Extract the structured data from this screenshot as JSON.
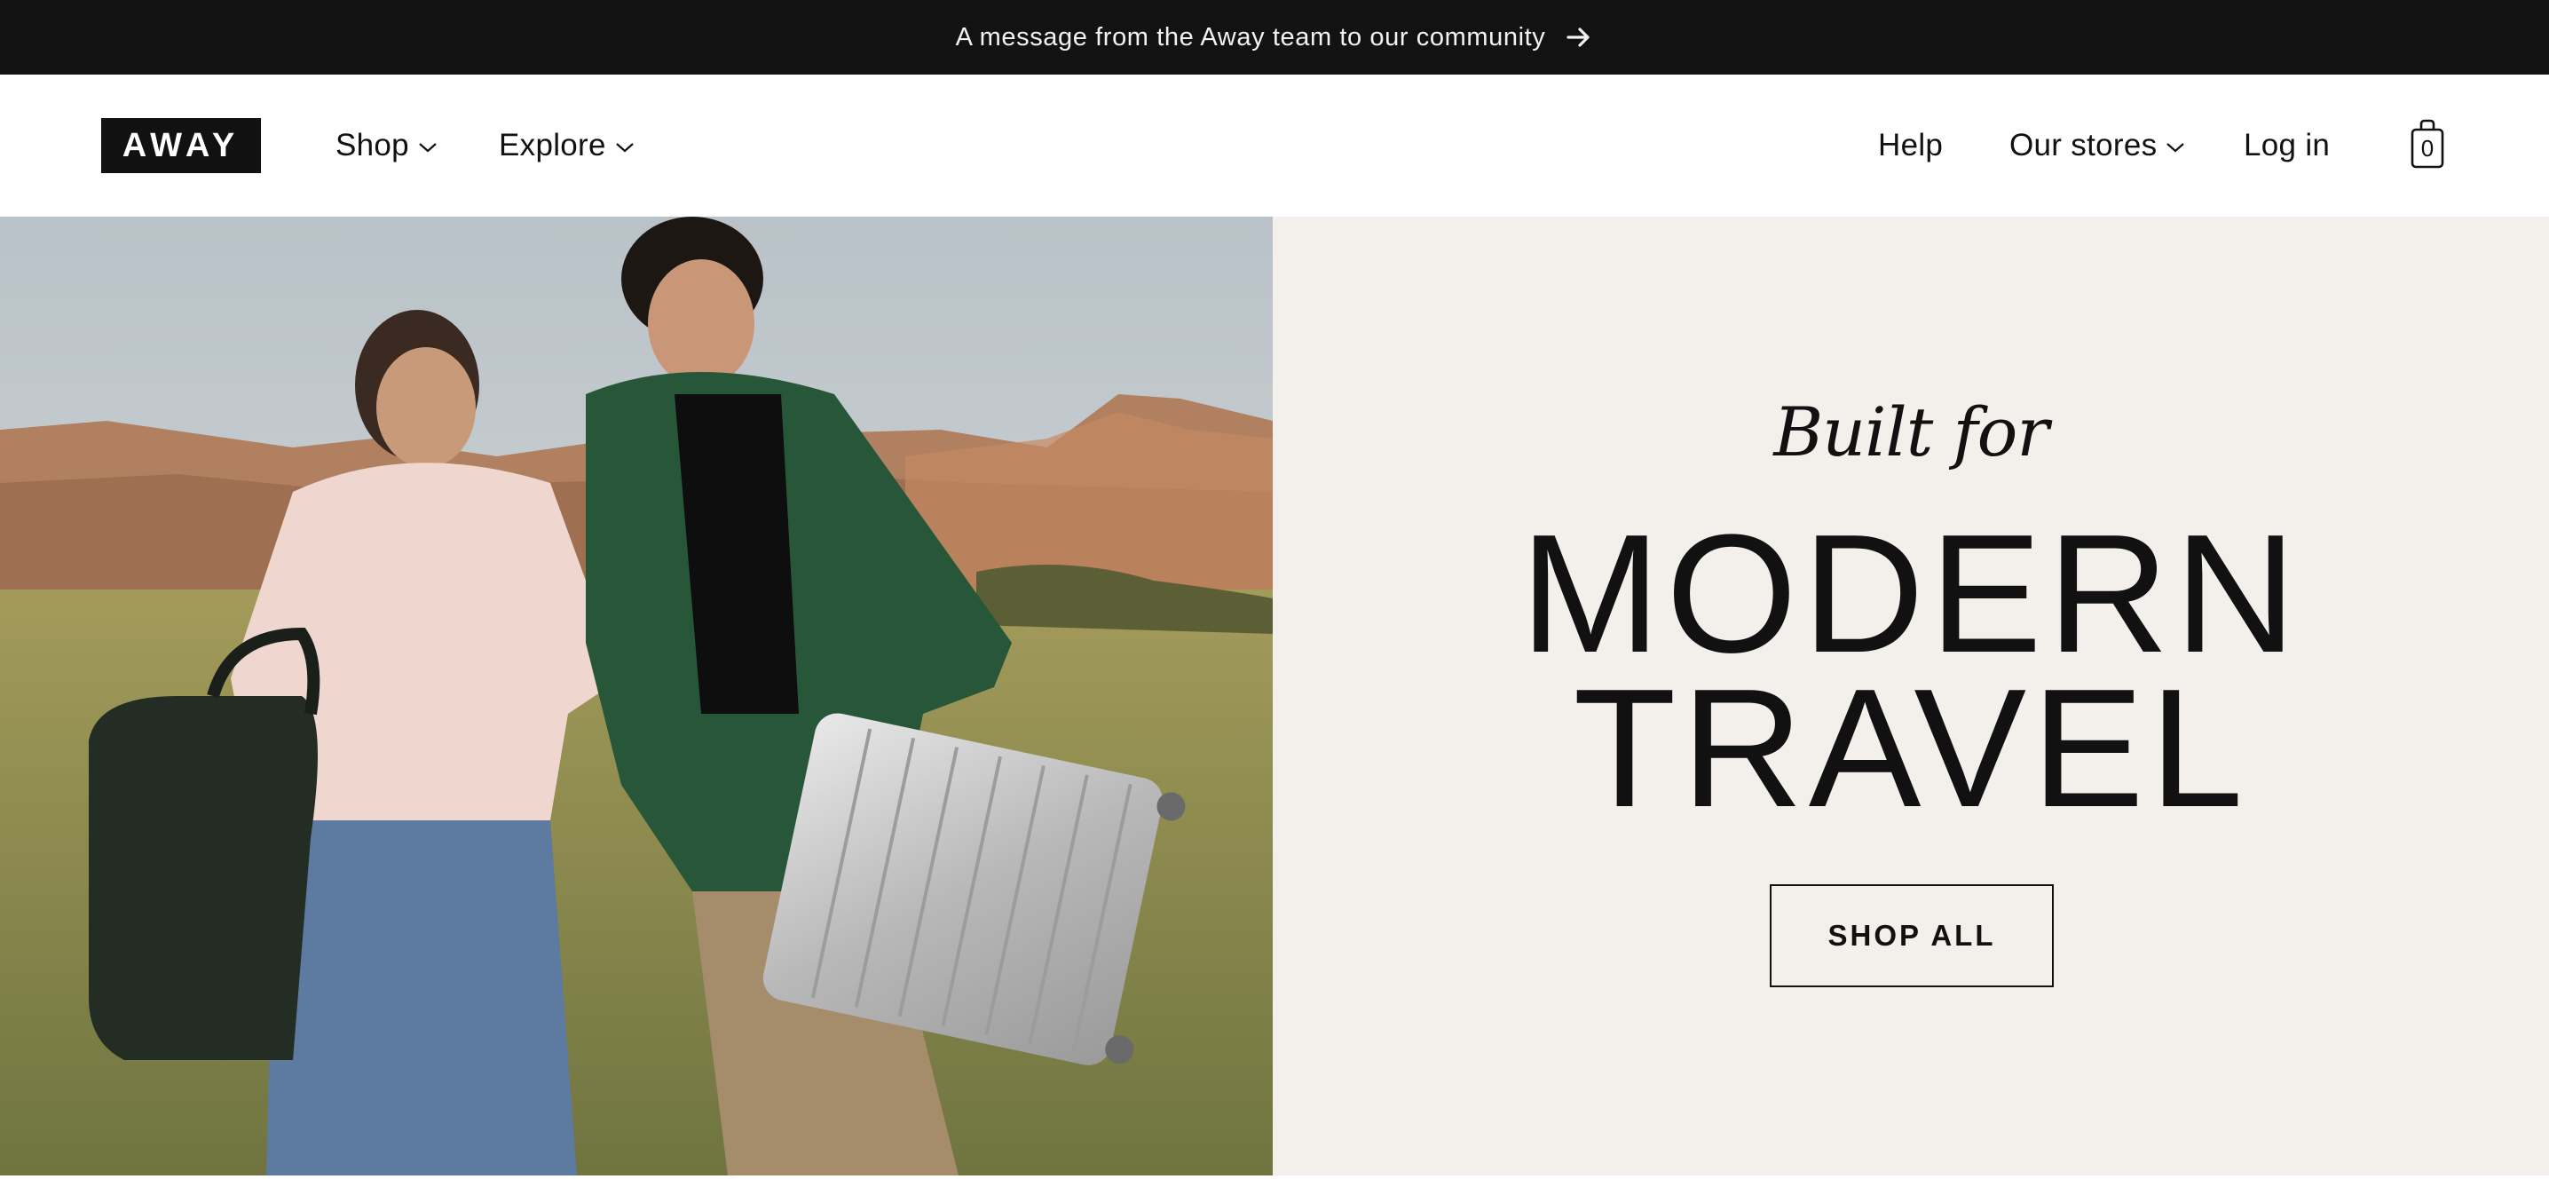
{
  "announcement": {
    "text": "A message from the Away team to our community",
    "icon": "arrow-right-icon"
  },
  "header": {
    "logo": "AWAY",
    "nav_left": [
      {
        "label": "Shop",
        "icon": "chevron-down-icon"
      },
      {
        "label": "Explore",
        "icon": "chevron-down-icon"
      }
    ],
    "nav_right": [
      {
        "label": "Help"
      },
      {
        "label": "Our stores",
        "icon": "chevron-down-icon"
      },
      {
        "label": "Log in"
      }
    ],
    "cart": {
      "icon": "shopping-bag-icon",
      "count": "0"
    }
  },
  "hero": {
    "eyebrow": "Built for",
    "headline_line1": "MODERN",
    "headline_line2": "TRAVEL",
    "cta_label": "SHOP ALL",
    "image_alt": "Two travelers walking through a grassy field with a duffel bag and an aluminum suitcase"
  },
  "colors": {
    "announcement_bg": "#121212",
    "panel_bg": "#f3efea",
    "ink": "#111111"
  }
}
